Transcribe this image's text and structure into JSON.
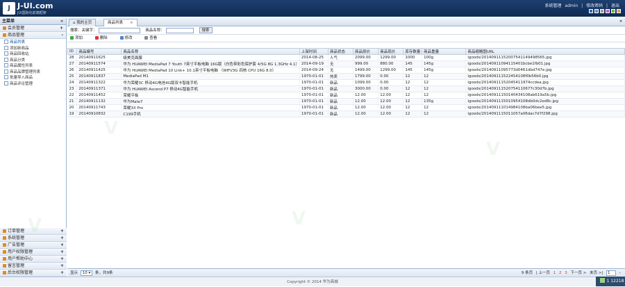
{
  "header": {
    "logo_text": "J",
    "brand": "J-UI.com",
    "brand_sub": "JUI国际化前端框架",
    "user_links": [
      "系统管理",
      "admin",
      "|",
      "修改密码",
      "|",
      "退出"
    ],
    "theme_colors": [
      "#2a6fbf",
      "#3b9ad8",
      "#9b9b9b",
      "#c45cc4",
      "#6fae4a",
      "#d9a13b"
    ]
  },
  "sidebar": {
    "title": "主菜单",
    "collapse_symbol": "«",
    "open_section": {
      "label": "会员管理",
      "toggle": "+"
    },
    "product_section": {
      "label": "商品管理",
      "toggle": "-"
    },
    "tree_items": [
      "商品列表",
      "添加新商品",
      "商品回收站",
      "商品分类",
      "商品属性列表",
      "商品品牌管理列表",
      "批量导入商品",
      "商品评论管理"
    ],
    "bottom_sections": [
      {
        "label": "订单管理",
        "toggle": "+"
      },
      {
        "label": "系统管理",
        "toggle": "+"
      },
      {
        "label": "广告管理",
        "toggle": "+"
      },
      {
        "label": "用户权限管理",
        "toggle": "+"
      },
      {
        "label": "用户帮助中心",
        "toggle": "+"
      },
      {
        "label": "留言管理",
        "toggle": "+"
      },
      {
        "label": "后台权限管理",
        "toggle": "+"
      }
    ]
  },
  "tabs": {
    "home": "我的主页",
    "current": "商品列表",
    "close": "×",
    "menu": "»"
  },
  "search": {
    "keyword_label": "搜索：关键字：",
    "name_label": "商品名称：",
    "button": "搜索"
  },
  "toolbar": {
    "add": "添加",
    "delete": "删除",
    "edit": "修改",
    "view": "查看"
  },
  "table": {
    "headers": [
      "ID",
      "商品编号",
      "商品名称",
      "上架时间",
      "商品状态",
      "商品原价",
      "商品现价",
      "库存数量",
      "商品重量",
      "商品缩略图URL"
    ],
    "rows": [
      [
        "28",
        "20140911625",
        "极美克面膜",
        "2014-08-25",
        "人气",
        "2099.00",
        "1299.00",
        "1000",
        "100g",
        "igoods/20140911152007541149498565.jpg"
      ],
      [
        "27",
        "20140911574",
        "华为 HUAWEI MediaPad 7 Youth 7英寸平板电脑 16G版（白色带彩色保护套 4/5G 8G 1.3GHz 4.1）",
        "2014-09-19",
        "无",
        "999.00",
        "880.00",
        "145",
        "145g",
        "igoods/20140911094115401bcbe1fb01.jpg"
      ],
      [
        "26",
        "20140911425",
        "华为 HUAWEI MediaPad 10 Link+ 10.1英寸平板电脑 （WIFI/3G 四核 CPU 16G 8.0）",
        "2014-09-24",
        "无",
        "1499.00",
        "1299.00",
        "145",
        "145g",
        "igoods/20140911095773d0461dbd747e.jpg"
      ],
      [
        "25",
        "20140911837",
        "MediaPad M1",
        "1970-01-01",
        "热卖",
        "1799.00",
        "0.00",
        "12",
        "12",
        "igoods/201409111522454108f0b56b0.jpg"
      ],
      [
        "24",
        "20140911322",
        "华为荣耀3C 移动4G电信4G版双卡智能手机",
        "1970-01-01",
        "新品",
        "1099.00",
        "0.00",
        "12",
        "12",
        "igoods/20140911152045411974ccdea.jpg"
      ],
      [
        "23",
        "20140911371",
        "华为 HUAWEI Ascend P7 移动4G智能手机",
        "1970-01-01",
        "新品",
        "3000.00",
        "0.00",
        "12",
        "12",
        "igoods/201409111520754110677c30d7b.jpg"
      ],
      [
        "22",
        "20140911452",
        "荣耀平板",
        "1970-01-01",
        "新品",
        "12.00",
        "12.00",
        "12",
        "12",
        "igoods/20140911150140434108ab619a5b.jpg"
      ],
      [
        "21",
        "20140911132",
        "华为Mate7",
        "1970-01-01",
        "新品",
        "12.00",
        "12.00",
        "12",
        "135g",
        "igoods/2014091115010954108db0dc2ed8c.jpg"
      ],
      [
        "20",
        "20140911743",
        "荣耀3X Pro",
        "1970-01-01",
        "新品",
        "12.00",
        "12.00",
        "12",
        "12",
        "igoods/201409111014984108ba06bee5.jpg"
      ],
      [
        "19",
        "20140910832",
        "C199手机",
        "1970-01-01",
        "新品",
        "12.00",
        "12.00",
        "12",
        "12",
        "igoods/2014091115011057a06dac7d7f298.jpg"
      ]
    ]
  },
  "pager": {
    "show_label": "显示",
    "page_size": "10",
    "total_label": "条，共9条",
    "nav": [
      "9 条页",
      "| 上一页",
      "1",
      "2",
      "3",
      "下一页 >",
      "末页 >|"
    ],
    "goto_value": "1",
    "goto_button": "›"
  },
  "footer": {
    "copyright": "Copyright © 2014 华为商城",
    "counter": "1 12218"
  },
  "colors": {
    "header_bg": "#1d3f70",
    "accent": "#9db3d1"
  }
}
